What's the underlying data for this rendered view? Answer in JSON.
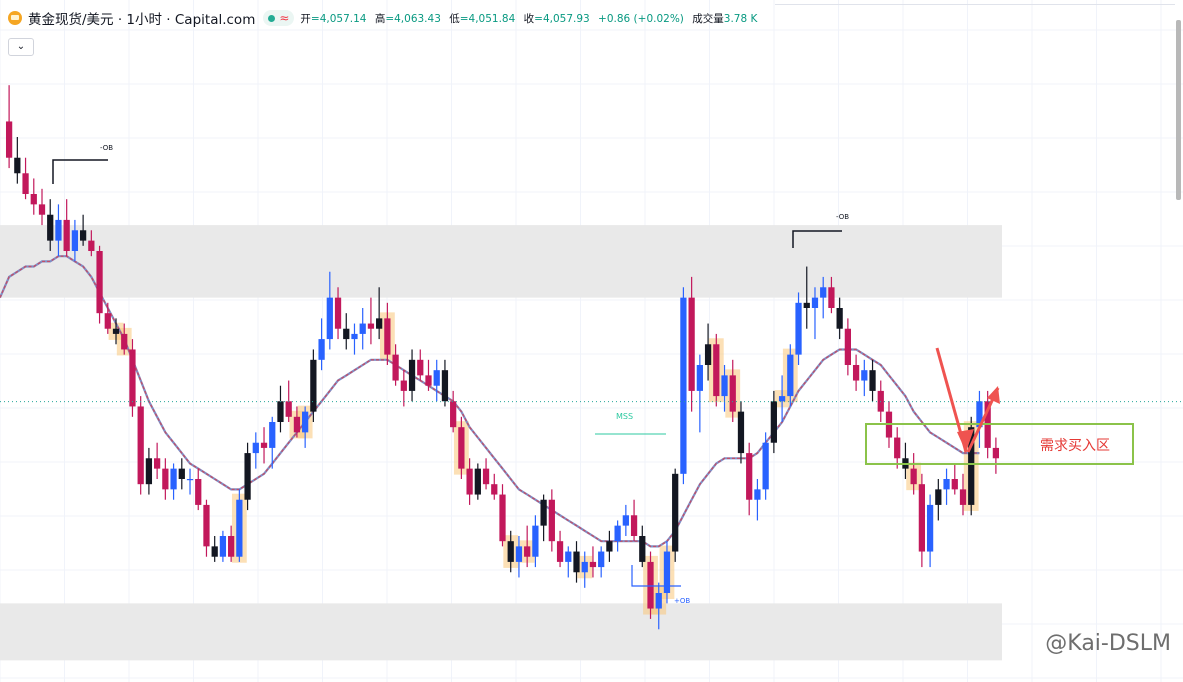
{
  "header": {
    "title": "黄金现货/美元 · 1小时 · Capital.com",
    "open_label": "开",
    "open": "=4,057.14",
    "high_label": "高",
    "high": "=4,063.43",
    "low_label": "低",
    "low": "=4,051.84",
    "close_label": "收",
    "close": "=4,057.93",
    "change": "+0.86 (+0.02%)",
    "volume_label": "成交量",
    "volume": "3.78 K",
    "collapse_icon": "chevron-down-icon"
  },
  "watermark": "@Kai-DSLM",
  "chart_data": {
    "type": "candlestick",
    "instrument": "黄金现货/美元",
    "timeframe": "1小时",
    "source": "Capital.com",
    "y_range": [
      4010,
      4120
    ],
    "y_axis_labels_visible": false,
    "grid": true,
    "colors": {
      "up": "#2962ff",
      "down": "#c2185b",
      "neutral": "#131722",
      "ma": "#a14d6a"
    },
    "candles": [
      {
        "o": 4112,
        "h": 4119,
        "l": 4103,
        "c": 4105
      },
      {
        "o": 4105,
        "h": 4109,
        "l": 4100,
        "c": 4102
      },
      {
        "o": 4102,
        "h": 4105,
        "l": 4097,
        "c": 4098
      },
      {
        "o": 4098,
        "h": 4101,
        "l": 4094,
        "c": 4096
      },
      {
        "o": 4096,
        "h": 4099,
        "l": 4092,
        "c": 4094
      },
      {
        "o": 4094,
        "h": 4097,
        "l": 4087,
        "c": 4089
      },
      {
        "o": 4089,
        "h": 4096,
        "l": 4086,
        "c": 4093
      },
      {
        "o": 4093,
        "h": 4097,
        "l": 4086,
        "c": 4087
      },
      {
        "o": 4087,
        "h": 4093,
        "l": 4085,
        "c": 4091
      },
      {
        "o": 4091,
        "h": 4094,
        "l": 4088,
        "c": 4089
      },
      {
        "o": 4089,
        "h": 4091,
        "l": 4086,
        "c": 4087
      },
      {
        "o": 4087,
        "h": 4088,
        "l": 4073,
        "c": 4075
      },
      {
        "o": 4075,
        "h": 4077,
        "l": 4071,
        "c": 4072
      },
      {
        "o": 4072,
        "h": 4074,
        "l": 4069,
        "c": 4071
      },
      {
        "o": 4071,
        "h": 4073,
        "l": 4067,
        "c": 4068
      },
      {
        "o": 4068,
        "h": 4070,
        "l": 4055,
        "c": 4057
      },
      {
        "o": 4057,
        "h": 4059,
        "l": 4040,
        "c": 4042
      },
      {
        "o": 4042,
        "h": 4049,
        "l": 4040,
        "c": 4047
      },
      {
        "o": 4047,
        "h": 4050,
        "l": 4043,
        "c": 4045
      },
      {
        "o": 4045,
        "h": 4047,
        "l": 4039,
        "c": 4041
      },
      {
        "o": 4041,
        "h": 4046,
        "l": 4039,
        "c": 4045
      },
      {
        "o": 4045,
        "h": 4047,
        "l": 4041,
        "c": 4043
      },
      {
        "o": 4043,
        "h": 4045,
        "l": 4040,
        "c": 4043
      },
      {
        "o": 4043,
        "h": 4045,
        "l": 4037,
        "c": 4038
      },
      {
        "o": 4038,
        "h": 4039,
        "l": 4028,
        "c": 4030
      },
      {
        "o": 4030,
        "h": 4032,
        "l": 4027,
        "c": 4028
      },
      {
        "o": 4028,
        "h": 4033,
        "l": 4027,
        "c": 4032
      },
      {
        "o": 4032,
        "h": 4034,
        "l": 4027,
        "c": 4028
      },
      {
        "o": 4028,
        "h": 4041,
        "l": 4027,
        "c": 4039
      },
      {
        "o": 4039,
        "h": 4050,
        "l": 4037,
        "c": 4048
      },
      {
        "o": 4048,
        "h": 4052,
        "l": 4045,
        "c": 4050
      },
      {
        "o": 4050,
        "h": 4053,
        "l": 4046,
        "c": 4049
      },
      {
        "o": 4049,
        "h": 4055,
        "l": 4045,
        "c": 4054
      },
      {
        "o": 4054,
        "h": 4061,
        "l": 4052,
        "c": 4058
      },
      {
        "o": 4058,
        "h": 4062,
        "l": 4054,
        "c": 4055
      },
      {
        "o": 4055,
        "h": 4057,
        "l": 4051,
        "c": 4052
      },
      {
        "o": 4052,
        "h": 4057,
        "l": 4049,
        "c": 4056
      },
      {
        "o": 4056,
        "h": 4068,
        "l": 4054,
        "c": 4066
      },
      {
        "o": 4066,
        "h": 4074,
        "l": 4064,
        "c": 4070
      },
      {
        "o": 4070,
        "h": 4083,
        "l": 4068,
        "c": 4078
      },
      {
        "o": 4078,
        "h": 4080,
        "l": 4070,
        "c": 4072
      },
      {
        "o": 4072,
        "h": 4075,
        "l": 4068,
        "c": 4070
      },
      {
        "o": 4070,
        "h": 4073,
        "l": 4067,
        "c": 4071
      },
      {
        "o": 4071,
        "h": 4076,
        "l": 4068,
        "c": 4073
      },
      {
        "o": 4073,
        "h": 4078,
        "l": 4069,
        "c": 4072
      },
      {
        "o": 4072,
        "h": 4080,
        "l": 4070,
        "c": 4074
      },
      {
        "o": 4074,
        "h": 4077,
        "l": 4065,
        "c": 4067
      },
      {
        "o": 4067,
        "h": 4069,
        "l": 4061,
        "c": 4062
      },
      {
        "o": 4062,
        "h": 4064,
        "l": 4057,
        "c": 4060
      },
      {
        "o": 4060,
        "h": 4068,
        "l": 4058,
        "c": 4066
      },
      {
        "o": 4066,
        "h": 4068,
        "l": 4062,
        "c": 4063
      },
      {
        "o": 4063,
        "h": 4066,
        "l": 4060,
        "c": 4061
      },
      {
        "o": 4061,
        "h": 4066,
        "l": 4058,
        "c": 4064
      },
      {
        "o": 4064,
        "h": 4066,
        "l": 4057,
        "c": 4058
      },
      {
        "o": 4058,
        "h": 4060,
        "l": 4052,
        "c": 4053
      },
      {
        "o": 4053,
        "h": 4055,
        "l": 4043,
        "c": 4045
      },
      {
        "o": 4045,
        "h": 4047,
        "l": 4038,
        "c": 4040
      },
      {
        "o": 4040,
        "h": 4046,
        "l": 4039,
        "c": 4045
      },
      {
        "o": 4045,
        "h": 4047,
        "l": 4041,
        "c": 4042
      },
      {
        "o": 4042,
        "h": 4044,
        "l": 4039,
        "c": 4040
      },
      {
        "o": 4040,
        "h": 4042,
        "l": 4030,
        "c": 4031
      },
      {
        "o": 4031,
        "h": 4033,
        "l": 4025,
        "c": 4027
      },
      {
        "o": 4027,
        "h": 4032,
        "l": 4024,
        "c": 4030
      },
      {
        "o": 4030,
        "h": 4034,
        "l": 4026,
        "c": 4028
      },
      {
        "o": 4028,
        "h": 4036,
        "l": 4026,
        "c": 4034
      },
      {
        "o": 4034,
        "h": 4040,
        "l": 4031,
        "c": 4039
      },
      {
        "o": 4039,
        "h": 4041,
        "l": 4029,
        "c": 4031
      },
      {
        "o": 4031,
        "h": 4033,
        "l": 4026,
        "c": 4027
      },
      {
        "o": 4027,
        "h": 4030,
        "l": 4024,
        "c": 4029
      },
      {
        "o": 4029,
        "h": 4031,
        "l": 4023,
        "c": 4025
      },
      {
        "o": 4025,
        "h": 4029,
        "l": 4022,
        "c": 4027
      },
      {
        "o": 4027,
        "h": 4030,
        "l": 4024,
        "c": 4026
      },
      {
        "o": 4026,
        "h": 4030,
        "l": 4024,
        "c": 4029
      },
      {
        "o": 4029,
        "h": 4033,
        "l": 4027,
        "c": 4031
      },
      {
        "o": 4031,
        "h": 4035,
        "l": 4029,
        "c": 4034
      },
      {
        "o": 4034,
        "h": 4038,
        "l": 4032,
        "c": 4036
      },
      {
        "o": 4036,
        "h": 4039,
        "l": 4031,
        "c": 4032
      },
      {
        "o": 4032,
        "h": 4034,
        "l": 4026,
        "c": 4027
      },
      {
        "o": 4027,
        "h": 4029,
        "l": 4016,
        "c": 4018
      },
      {
        "o": 4018,
        "h": 4023,
        "l": 4014,
        "c": 4021
      },
      {
        "o": 4021,
        "h": 4031,
        "l": 4019,
        "c": 4029
      },
      {
        "o": 4029,
        "h": 4045,
        "l": 4027,
        "c": 4044
      },
      {
        "o": 4044,
        "h": 4080,
        "l": 4042,
        "c": 4078
      },
      {
        "o": 4078,
        "h": 4082,
        "l": 4056,
        "c": 4060
      },
      {
        "o": 4060,
        "h": 4067,
        "l": 4052,
        "c": 4065
      },
      {
        "o": 4065,
        "h": 4073,
        "l": 4062,
        "c": 4069
      },
      {
        "o": 4069,
        "h": 4071,
        "l": 4057,
        "c": 4059
      },
      {
        "o": 4059,
        "h": 4065,
        "l": 4056,
        "c": 4063
      },
      {
        "o": 4063,
        "h": 4066,
        "l": 4054,
        "c": 4056
      },
      {
        "o": 4056,
        "h": 4058,
        "l": 4046,
        "c": 4048
      },
      {
        "o": 4048,
        "h": 4050,
        "l": 4036,
        "c": 4039
      },
      {
        "o": 4039,
        "h": 4043,
        "l": 4035,
        "c": 4041
      },
      {
        "o": 4041,
        "h": 4052,
        "l": 4039,
        "c": 4050
      },
      {
        "o": 4050,
        "h": 4060,
        "l": 4048,
        "c": 4058
      },
      {
        "o": 4058,
        "h": 4063,
        "l": 4054,
        "c": 4059
      },
      {
        "o": 4059,
        "h": 4069,
        "l": 4057,
        "c": 4067
      },
      {
        "o": 4067,
        "h": 4079,
        "l": 4065,
        "c": 4077
      },
      {
        "o": 4077,
        "h": 4084,
        "l": 4072,
        "c": 4076
      },
      {
        "o": 4076,
        "h": 4080,
        "l": 4070,
        "c": 4078
      },
      {
        "o": 4078,
        "h": 4082,
        "l": 4074,
        "c": 4080
      },
      {
        "o": 4080,
        "h": 4082,
        "l": 4075,
        "c": 4076
      },
      {
        "o": 4076,
        "h": 4078,
        "l": 4070,
        "c": 4072
      },
      {
        "o": 4072,
        "h": 4074,
        "l": 4063,
        "c": 4065
      },
      {
        "o": 4065,
        "h": 4067,
        "l": 4060,
        "c": 4062
      },
      {
        "o": 4062,
        "h": 4066,
        "l": 4059,
        "c": 4064
      },
      {
        "o": 4064,
        "h": 4066,
        "l": 4058,
        "c": 4060
      },
      {
        "o": 4060,
        "h": 4062,
        "l": 4054,
        "c": 4056
      },
      {
        "o": 4056,
        "h": 4058,
        "l": 4049,
        "c": 4051
      },
      {
        "o": 4051,
        "h": 4053,
        "l": 4045,
        "c": 4047
      },
      {
        "o": 4047,
        "h": 4050,
        "l": 4043,
        "c": 4045
      },
      {
        "o": 4045,
        "h": 4048,
        "l": 4040,
        "c": 4042
      },
      {
        "o": 4042,
        "h": 4044,
        "l": 4026,
        "c": 4029
      },
      {
        "o": 4029,
        "h": 4040,
        "l": 4026,
        "c": 4038
      },
      {
        "o": 4038,
        "h": 4043,
        "l": 4035,
        "c": 4041
      },
      {
        "o": 4041,
        "h": 4045,
        "l": 4038,
        "c": 4043
      },
      {
        "o": 4043,
        "h": 4046,
        "l": 4040,
        "c": 4041
      },
      {
        "o": 4041,
        "h": 4044,
        "l": 4036,
        "c": 4038
      },
      {
        "o": 4038,
        "h": 4055,
        "l": 4036,
        "c": 4053
      },
      {
        "o": 4053,
        "h": 4060,
        "l": 4049,
        "c": 4058
      },
      {
        "o": 4058,
        "h": 4060,
        "l": 4047,
        "c": 4049
      },
      {
        "o": 4049,
        "h": 4051,
        "l": 4044,
        "c": 4047
      }
    ],
    "moving_average": {
      "name": "",
      "values": [
        4082,
        4083,
        4084,
        4084,
        4085,
        4085,
        4086,
        4086,
        4085,
        4084,
        4082,
        4079,
        4076,
        4073,
        4070,
        4066,
        4062,
        4058,
        4055,
        4052,
        4050,
        4048,
        4046,
        4045,
        4044,
        4043,
        4042,
        4041,
        4041,
        4042,
        4043,
        4044,
        4046,
        4048,
        4050,
        4052,
        4054,
        4056,
        4058,
        4060,
        4062,
        4063,
        4064,
        4065,
        4066,
        4066,
        4066,
        4065,
        4064,
        4063,
        4062,
        4061,
        4060,
        4059,
        4058,
        4056,
        4053,
        4051,
        4049,
        4047,
        4045,
        4043,
        4041,
        4040,
        4039,
        4038,
        4037,
        4036,
        4035,
        4034,
        4033,
        4032,
        4031,
        4031,
        4031,
        4031,
        4031,
        4031,
        4030,
        4030,
        4031,
        4033,
        4036,
        4039,
        4042,
        4044,
        4046,
        4047,
        4047,
        4047,
        4047,
        4048,
        4050,
        4052,
        4054,
        4057,
        4060,
        4062,
        4064,
        4066,
        4067,
        4068,
        4068,
        4068,
        4067,
        4066,
        4065,
        4063,
        4061,
        4059,
        4056,
        4054,
        4052,
        4051,
        4050,
        4049,
        4048,
        4048,
        4048
      ]
    },
    "zones": [
      {
        "label": "",
        "y_from": 4078,
        "y_to": 4092,
        "color": "#e9e9e9"
      },
      {
        "label": "",
        "y_from": 4008,
        "y_to": 4019,
        "color": "#e9e9e9"
      }
    ],
    "annotations": [
      {
        "text": "-OB",
        "color": "#131722"
      },
      {
        "text": "-OB",
        "color": "#131722"
      },
      {
        "text": "MSS",
        "color": "#2cc9a0"
      },
      {
        "text": "+OB",
        "color": "#2962ff"
      },
      {
        "text": "需求买入区",
        "color": "#e53935",
        "box_color": "#8bc34a"
      }
    ],
    "current_price_line": 4057.93
  }
}
